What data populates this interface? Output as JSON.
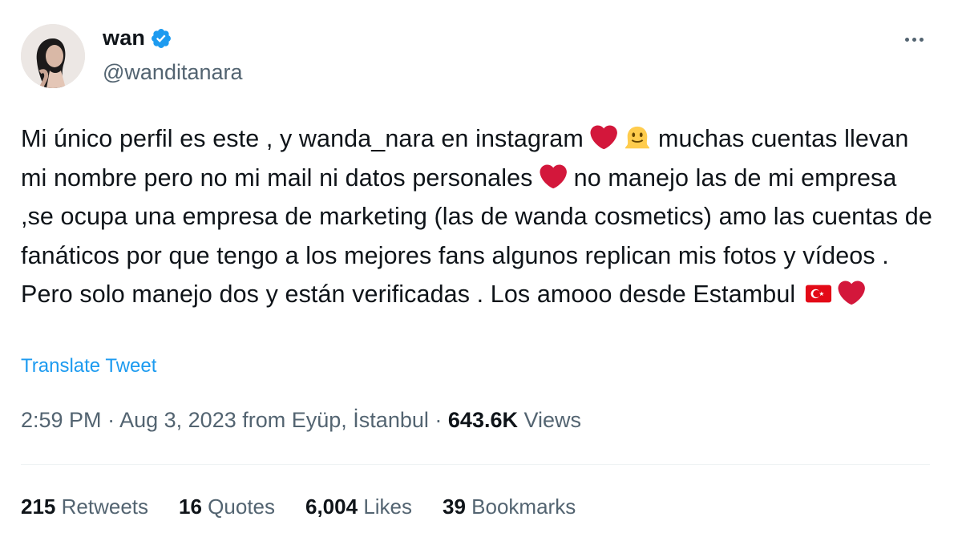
{
  "author": {
    "name": "wan",
    "handle": "@wanditanara"
  },
  "tweet": {
    "segments": [
      "Mi único perfil es este , y wanda_nara en instagram ",
      " muchas cuentas llevan mi nombre pero no mi mail ni datos personales ",
      " no manejo  las de mi empresa ,se ocupa una empresa de marketing (las de wanda cosmetics) amo las cuentas de fanáticos por que tengo a los mejores fans  algunos replican mis fotos y vídeos . Pero solo manejo dos y están verificadas . Los amooo desde Estambul "
    ],
    "emojis": [
      "red-heart",
      "melting-face",
      "red-heart",
      "turkey-flag",
      "red-heart"
    ],
    "translate_label": "Translate Tweet"
  },
  "meta": {
    "time": "2:59 PM",
    "date": "Aug 3, 2023",
    "location": "from Eyüp, İstanbul",
    "separator": "·",
    "views_count": "643.6K",
    "views_label": "Views"
  },
  "stats": {
    "retweets": {
      "count": "215",
      "label": "Retweets"
    },
    "quotes": {
      "count": "16",
      "label": "Quotes"
    },
    "likes": {
      "count": "6,004",
      "label": "Likes"
    },
    "bookmarks": {
      "count": "39",
      "label": "Bookmarks"
    }
  },
  "colors": {
    "accent": "#1d9bf0",
    "secondary_text": "#536471",
    "primary_text": "#0f1419",
    "heart": "#d3173b"
  }
}
